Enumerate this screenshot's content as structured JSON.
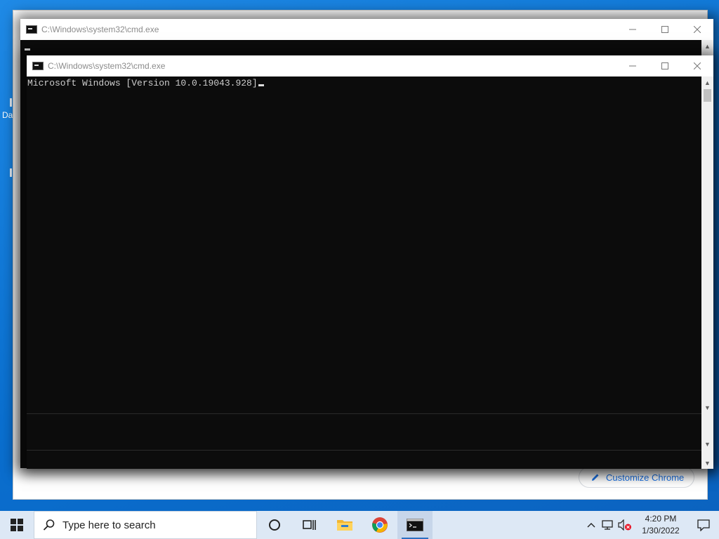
{
  "desktop": {
    "label_partial": "Da"
  },
  "background_window": {
    "customize_label": "Customize Chrome"
  },
  "back_cmd": {
    "title": "C:\\Windows\\system32\\cmd.exe",
    "icon": "cmd-icon"
  },
  "front_cmd": {
    "title": "C:\\Windows\\system32\\cmd.exe",
    "icon": "cmd-icon",
    "console_line": "Microsoft Windows [Version 10.0.19043.928]"
  },
  "taskbar": {
    "search_placeholder": "Type here to search",
    "apps": [
      "task-view",
      "file-explorer",
      "chrome",
      "command-prompt"
    ],
    "clock_time": "4:20 PM",
    "clock_date": "1/30/2022"
  },
  "colors": {
    "console_bg": "#0c0c0c",
    "console_fg": "#cccccc",
    "desktop": "#0a78d7",
    "taskbar": "#dde8f5",
    "chrome_accent": "#1a73e8"
  }
}
